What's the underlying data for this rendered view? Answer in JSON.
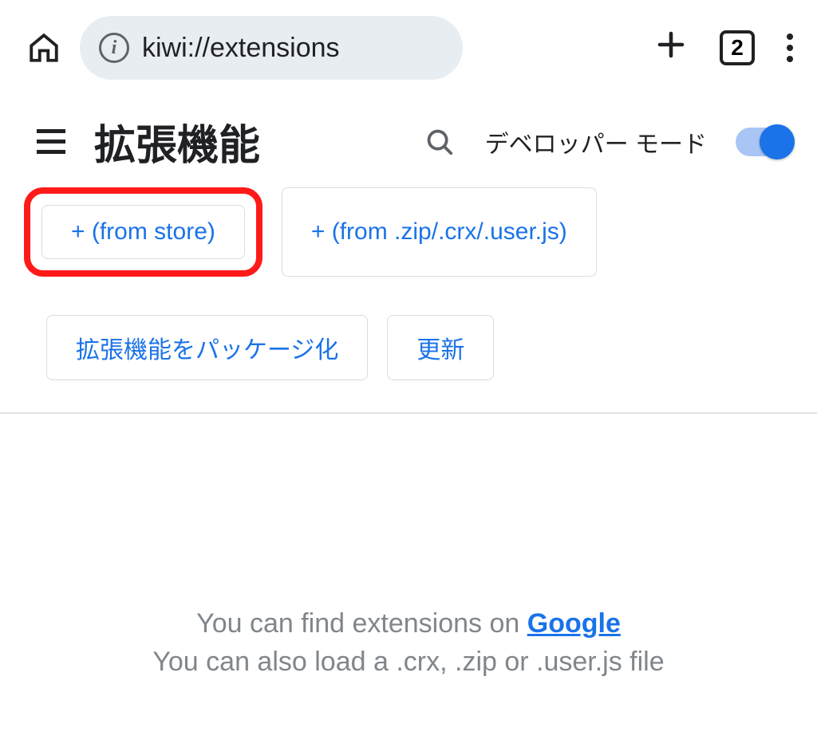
{
  "browser": {
    "url": "kiwi://extensions",
    "tab_count": "2"
  },
  "toolbar": {
    "title": "拡張機能",
    "dev_mode_label": "デベロッパー モード"
  },
  "buttons": {
    "from_store": "+ (from store)",
    "from_file": "+ (from .zip/.crx/.user.js)",
    "pack": "拡張機能をパッケージ化",
    "update": "更新"
  },
  "empty": {
    "line1_prefix": "You can find extensions on ",
    "line1_link": "Google",
    "line2": "You can also load a .crx, .zip or .user.js file"
  }
}
